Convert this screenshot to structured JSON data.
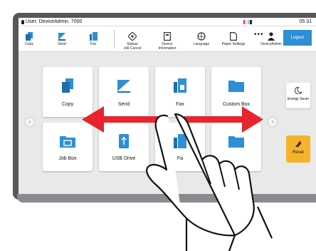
{
  "status_bar": {
    "user": "User: DeviceAdmin. 7000",
    "time": "05:31",
    "indicator_colors": [
      "#e0208c",
      "#f0d020",
      "#f0d020",
      "#3aa9dd",
      "#222222"
    ]
  },
  "toolbar": {
    "items": [
      {
        "label": "Copy",
        "icon": "copy-icon"
      },
      {
        "label": "Send",
        "icon": "send-icon"
      },
      {
        "label": "Fax",
        "icon": "fax-icon"
      },
      {
        "label": "Status/\nJob Cancel",
        "icon": "status-icon"
      },
      {
        "label": "Device\nInformation",
        "icon": "device-info-icon"
      },
      {
        "label": "Language",
        "icon": "language-icon"
      },
      {
        "label": "Paper Settings",
        "icon": "paper-settings-icon"
      },
      {
        "label": "DeviceAdmin",
        "icon": "user-icon"
      }
    ],
    "more": "•••",
    "logout": "Logout"
  },
  "tiles": [
    {
      "label": "Copy",
      "icon": "copy-icon"
    },
    {
      "label": "Send",
      "icon": "send-icon"
    },
    {
      "label": "Fax",
      "icon": "fax-icon"
    },
    {
      "label": "Custom Box",
      "icon": "folder-icon"
    },
    {
      "label": "Job Box",
      "icon": "job-box-icon"
    },
    {
      "label": "USB Drive",
      "icon": "usb-drive-icon"
    },
    {
      "label": "Fa",
      "icon": "fax-icon"
    }
  ],
  "nav": {
    "prev": "‹",
    "next": "›"
  },
  "side": {
    "energy_saver": "Energy Saver",
    "reset": "Reset"
  },
  "colors": {
    "brand_blue": "#2d8fd6",
    "reset_yellow": "#f7b22c",
    "arrow_red": "#e8242c"
  }
}
